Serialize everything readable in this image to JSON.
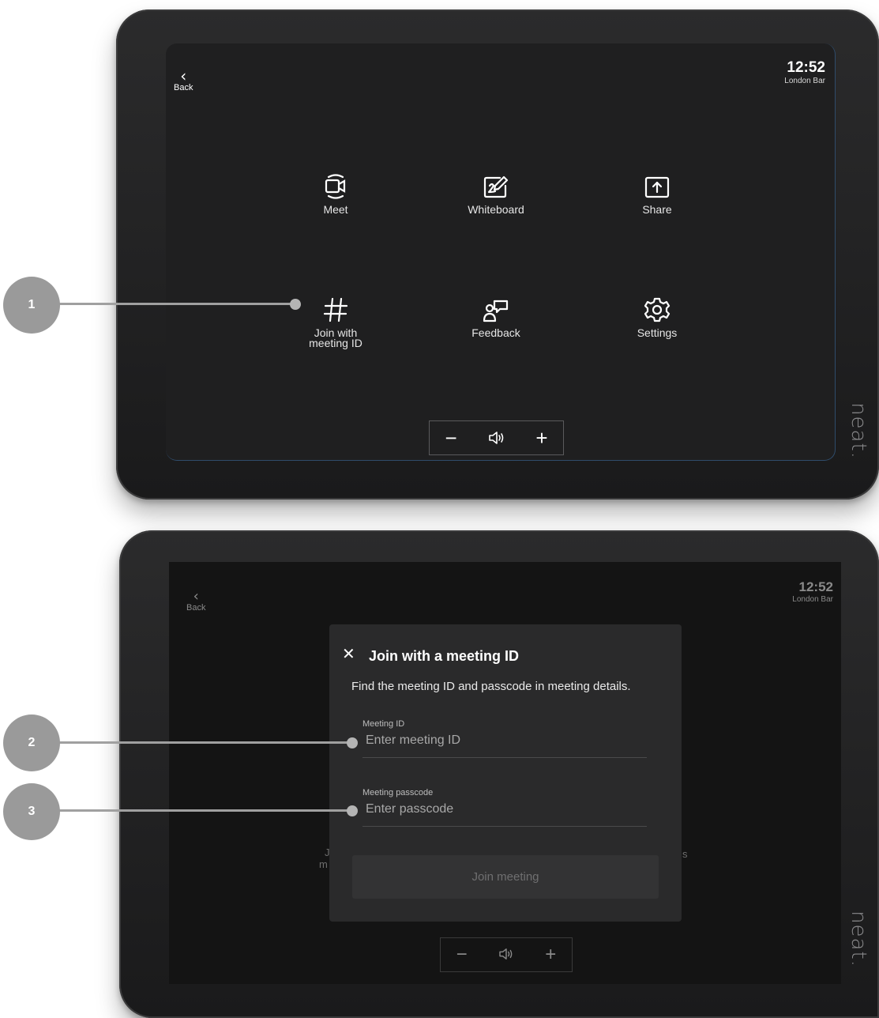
{
  "brand": "neat.",
  "screen1": {
    "back_label": "Back",
    "time": "12:52",
    "location": "London Bar",
    "tiles": [
      {
        "label": "Meet",
        "icon": "video-camera-icon"
      },
      {
        "label": "Whiteboard",
        "icon": "whiteboard-pen-icon"
      },
      {
        "label": "Share",
        "icon": "share-upload-icon"
      },
      {
        "label": "Join with\nmeeting ID",
        "icon": "hash-icon"
      },
      {
        "label": "Feedback",
        "icon": "feedback-icon"
      },
      {
        "label": "Settings",
        "icon": "gear-icon"
      }
    ],
    "volume": {
      "minus": "−",
      "speaker": "speaker-icon",
      "plus": "+"
    }
  },
  "screen2": {
    "back_label": "Back",
    "time": "12:52",
    "location": "London Bar",
    "dialog": {
      "title": "Join with a meeting ID",
      "subtitle": "Find the meeting ID and passcode in meeting details.",
      "meeting_id_label": "Meeting ID",
      "meeting_id_placeholder": "Enter meeting ID",
      "passcode_label": "Meeting passcode",
      "passcode_placeholder": "Enter passcode",
      "join_button": "Join meeting"
    },
    "background_partial": {
      "left_1": "J",
      "left_2": "m",
      "right_1": "s"
    },
    "volume": {
      "minus": "−",
      "speaker": "speaker-icon",
      "plus": "+"
    }
  },
  "callouts": [
    "1",
    "2",
    "3"
  ]
}
